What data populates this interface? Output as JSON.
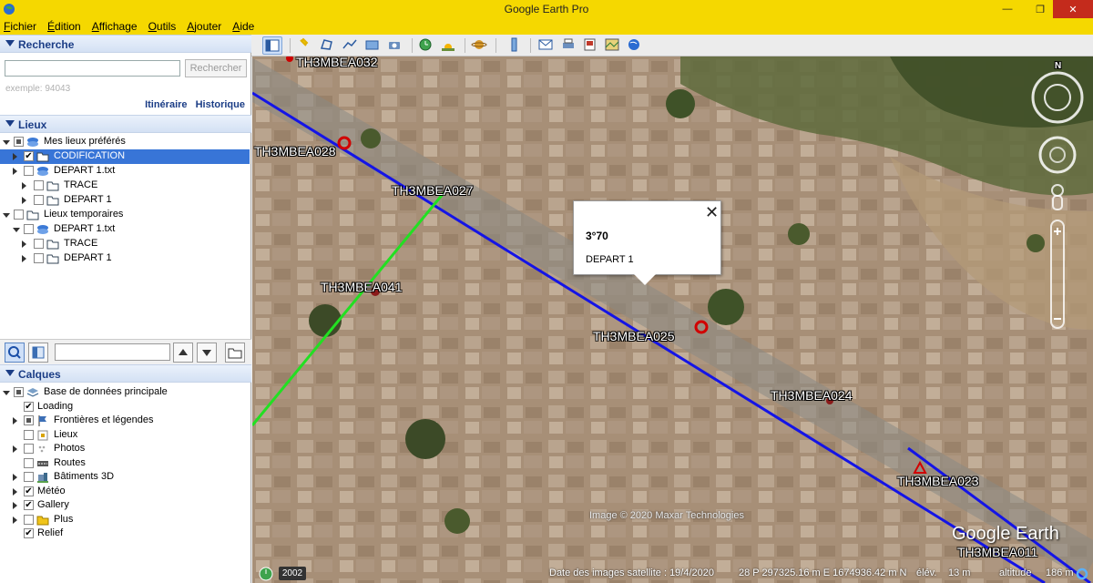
{
  "window": {
    "title": "Google Earth Pro",
    "minimize": "—",
    "maximize": "❐",
    "close": "✕"
  },
  "menu": [
    "Fichier",
    "Édition",
    "Affichage",
    "Outils",
    "Ajouter",
    "Aide"
  ],
  "search_panel": {
    "title": "Recherche",
    "input_value": "",
    "button": "Rechercher",
    "hint": "exemple: 94043",
    "link_itineraire": "Itinéraire",
    "link_historique": "Historique"
  },
  "places_panel": {
    "title": "Lieux",
    "items": [
      {
        "label": "Mes lieux préférés"
      },
      {
        "label": "CODIFICATION"
      },
      {
        "label": "DEPART 1.txt"
      },
      {
        "label": "TRACE"
      },
      {
        "label": "DEPART 1"
      },
      {
        "label": "Lieux temporaires"
      },
      {
        "label": "DEPART 1.txt"
      },
      {
        "label": "TRACE"
      },
      {
        "label": "DEPART 1"
      }
    ]
  },
  "layers_panel": {
    "title": "Calques",
    "items": [
      {
        "label": "Base de données principale"
      },
      {
        "label": "Loading"
      },
      {
        "label": "Frontières et légendes"
      },
      {
        "label": "Lieux"
      },
      {
        "label": "Photos"
      },
      {
        "label": "Routes"
      },
      {
        "label": "Bâtiments 3D"
      },
      {
        "label": "Météo"
      },
      {
        "label": "Gallery"
      },
      {
        "label": "Plus"
      },
      {
        "label": "Relief"
      }
    ]
  },
  "map": {
    "placemarks": [
      {
        "label": "TH3MBEA032"
      },
      {
        "label": "TH3MBEA028"
      },
      {
        "label": "TH3MBEA027"
      },
      {
        "label": "TH3MBEA041"
      },
      {
        "label": "TH3MBEA025"
      },
      {
        "label": "TH3MBEA024"
      },
      {
        "label": "TH3MBEA023"
      },
      {
        "label": "TH3MBEA011"
      }
    ],
    "popup": {
      "title": "3°70",
      "description": "DEPART 1",
      "close": "✕"
    },
    "copyright": "Image © 2020 Maxar Technologies",
    "logo": "Google Earth",
    "compass_n": "N",
    "line_colors": {
      "main": "#1414e6",
      "branch": "#22e022"
    }
  },
  "status": {
    "year": "2002",
    "imagery_date": "Date des images satellite : 19/4/2020",
    "coords": "28 P 297325.16 m E 1674936.42 m N",
    "elevation_label": "élév.",
    "elevation": "13 m",
    "altitude_label": "altitude",
    "altitude": "186 m"
  }
}
